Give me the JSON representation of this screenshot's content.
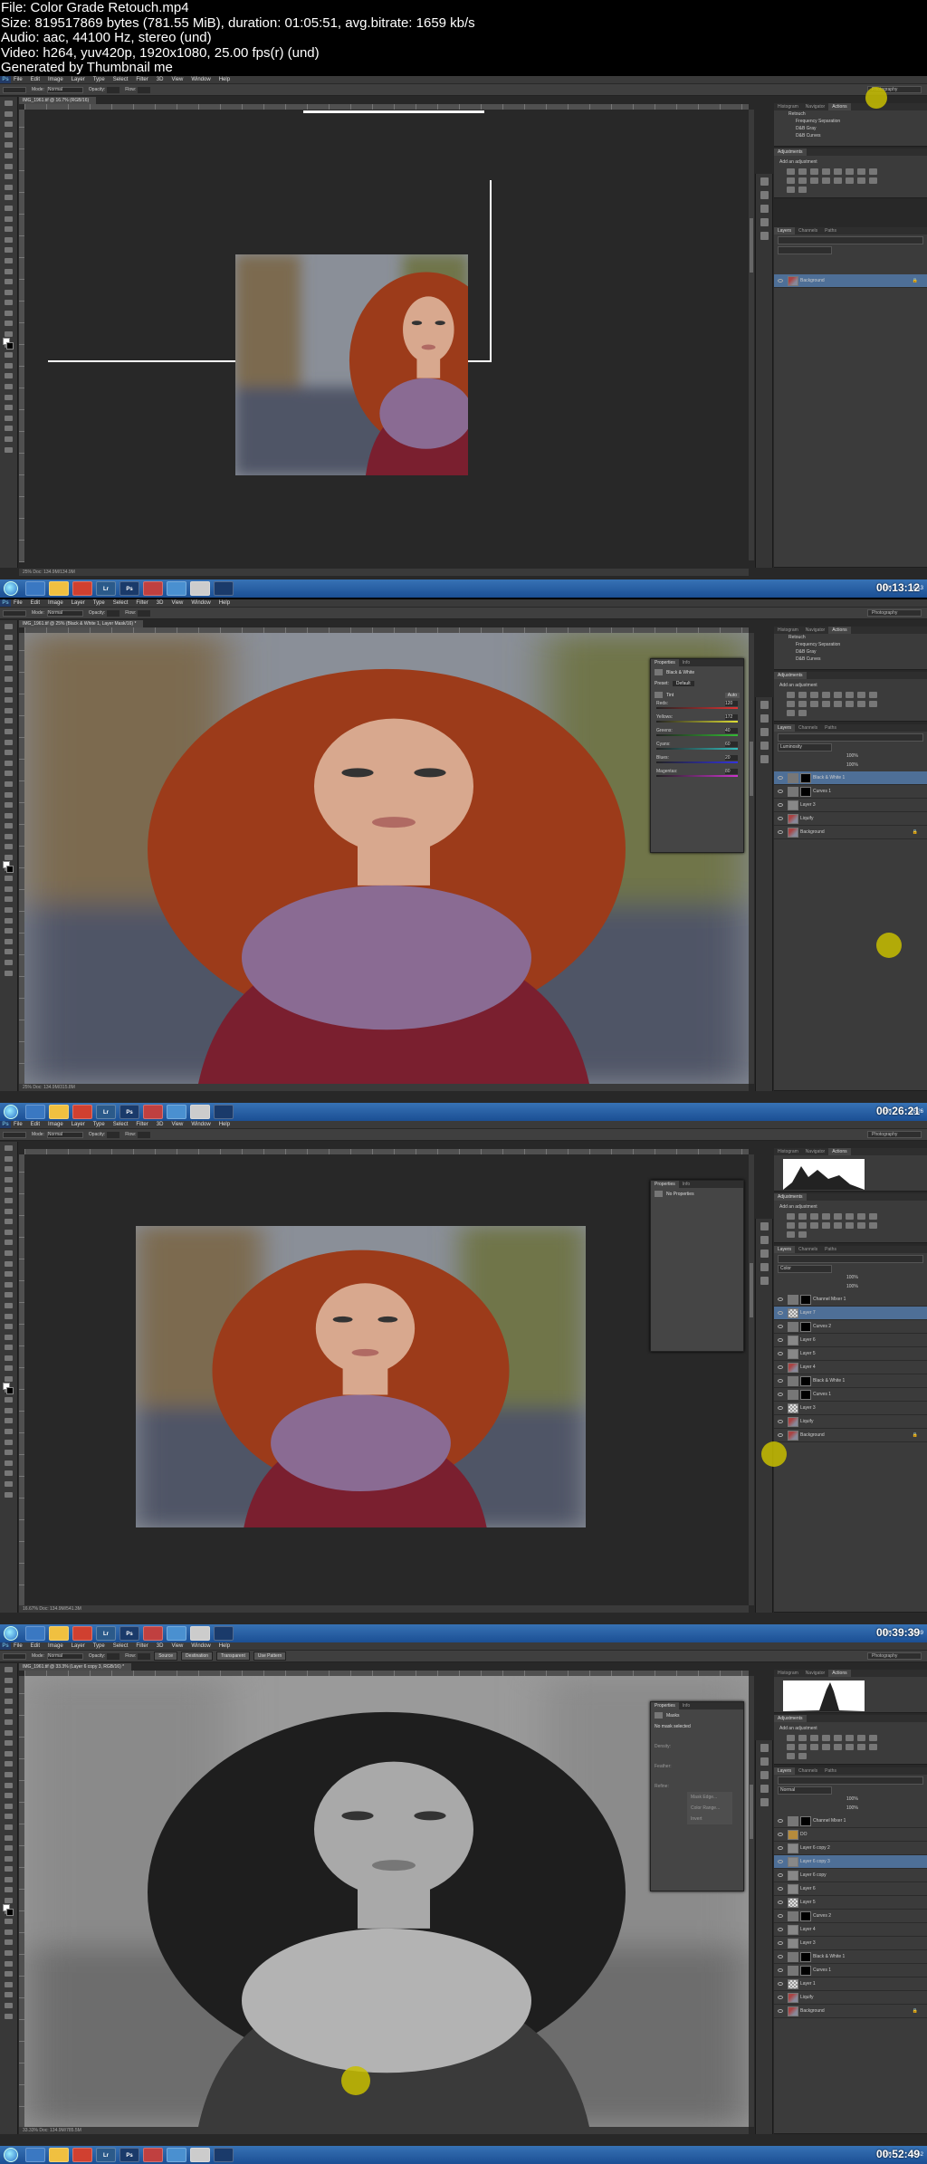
{
  "file_info": {
    "filename": "File: Color Grade Retouch.mp4",
    "size": "Size: 819517869 bytes (781.55 MiB), duration: 01:05:51, avg.bitrate: 1659 kb/s",
    "audio": "Audio: aac, 44100 Hz, stereo (und)",
    "video": "Video: h264, yuv420p, 1920x1080, 25.00 fps(r) (und)",
    "generator": "Generated by Thumbnail me"
  },
  "menus": [
    "File",
    "Edit",
    "Image",
    "Layer",
    "Type",
    "Select",
    "Filter",
    "3D",
    "View",
    "Window",
    "Help"
  ],
  "app_logo": "Ps",
  "workspace": "Photography",
  "options": {
    "mode_label": "Mode:",
    "mode_value": "Normal",
    "opacity_label": "Opacity:",
    "flow_label": "Flow:"
  },
  "panel_tabs": {
    "history": "Histogram",
    "navigator": "Navigator",
    "actions": "Actions",
    "properties": "Properties",
    "info": "Info",
    "adjustments": "Adjustments",
    "layers": "Layers",
    "channels": "Channels",
    "paths": "Paths"
  },
  "adjust_heading": "Add an adjustment",
  "actions_rows": [
    "Retouch",
    "Frequency Separation",
    "D&B Gray",
    "D&B Curves"
  ],
  "taskbar": {
    "lang": "EN",
    "apps": [
      "",
      "",
      "",
      "Lr",
      "Ps",
      "",
      "",
      "",
      ""
    ]
  },
  "frames": [
    {
      "doc_tab": "IMG_1961.tif @ 16.7% (RGB/16)",
      "status": "25%   Doc: 134.9M/134.9M",
      "timestamp": "00:13:12",
      "clock_time": "16:13",
      "clock_date": "",
      "layers": [
        {
          "name": "Background",
          "sel": true,
          "lock": true,
          "thumb": "photo"
        }
      ],
      "properties": null
    },
    {
      "doc_tab": "IMG_1961.tif @ 25% (Black & White 1, Layer Mask/16) *",
      "status": "25%   Doc: 134.9M/315.8M",
      "timestamp": "00:26:21",
      "clock_time": "16:26",
      "clock_date": "",
      "blend_mode": "Luminosity",
      "opacity": "100%",
      "fill": "100%",
      "layers": [
        {
          "name": "Black & White 1",
          "sel": true,
          "thumb": "adj"
        },
        {
          "name": "Curves 1",
          "thumb": "adj"
        },
        {
          "name": "Layer 3",
          "thumb": "gray"
        },
        {
          "name": "Liquify",
          "thumb": "photo"
        },
        {
          "name": "Background",
          "lock": true,
          "thumb": "photo"
        }
      ],
      "properties": {
        "title": "Black & White",
        "preset_label": "Preset:",
        "preset_value": "Default",
        "tint": "Tint",
        "auto": "Auto",
        "sliders": [
          {
            "label": "Reds:",
            "value": "120"
          },
          {
            "label": "Yellows:",
            "value": "172"
          },
          {
            "label": "Greens:",
            "value": "40"
          },
          {
            "label": "Cyans:",
            "value": "60"
          },
          {
            "label": "Blues:",
            "value": "20"
          },
          {
            "label": "Magentas:",
            "value": "80"
          }
        ]
      }
    },
    {
      "doc_tab": "",
      "status": "16.67%   Doc: 134.9M/541.3M",
      "timestamp": "00:39:39",
      "clock_time": "16:39",
      "clock_date": "",
      "blend_mode": "Color",
      "opacity": "100%",
      "fill": "100%",
      "layers": [
        {
          "name": "Channel Mixer 1",
          "thumb": "adj"
        },
        {
          "name": "Layer 7",
          "sel": true,
          "thumb": "check"
        },
        {
          "name": "Curves 2",
          "thumb": "adj"
        },
        {
          "name": "Layer 6",
          "thumb": "gray"
        },
        {
          "name": "Layer 5",
          "thumb": "gray"
        },
        {
          "name": "Layer 4",
          "thumb": "photo"
        },
        {
          "name": "Black & White 1",
          "thumb": "adj"
        },
        {
          "name": "Curves 1",
          "thumb": "adj"
        },
        {
          "name": "Layer 3",
          "thumb": "check"
        },
        {
          "name": "Liquify",
          "thumb": "photo"
        },
        {
          "name": "Background",
          "lock": true,
          "thumb": "photo"
        }
      ],
      "properties": {
        "title": "No Properties"
      }
    },
    {
      "doc_tab": "IMG_1961.tif @ 33.3% (Layer 6 copy 3, RGB/16) *",
      "status": "33.33%   Doc: 134.9M/785.5M",
      "timestamp": "00:52:49",
      "clock_time": "16:52",
      "clock_date": "",
      "options_extra": [
        "Source",
        "Destination",
        "Transparent",
        "Use Pattern"
      ],
      "blend_mode": "Normal",
      "opacity": "100%",
      "fill": "100%",
      "layers": [
        {
          "name": "Channel Mixer 1",
          "thumb": "adj"
        },
        {
          "name": "DO",
          "thumb": "folder"
        },
        {
          "name": "Layer 6 copy 2",
          "thumb": "gray"
        },
        {
          "name": "Layer 6 copy 3",
          "sel": true,
          "thumb": "gray"
        },
        {
          "name": "Layer 6 copy",
          "thumb": "gray"
        },
        {
          "name": "Layer 6",
          "thumb": "gray"
        },
        {
          "name": "Layer 5",
          "thumb": "check"
        },
        {
          "name": "Curves 2",
          "thumb": "adj"
        },
        {
          "name": "Layer 4",
          "thumb": "gray"
        },
        {
          "name": "Layer 3",
          "thumb": "gray"
        },
        {
          "name": "Black & White 1",
          "thumb": "adj"
        },
        {
          "name": "Curves 1",
          "thumb": "adj"
        },
        {
          "name": "Layer 1",
          "thumb": "check"
        },
        {
          "name": "Liquify",
          "thumb": "photo"
        },
        {
          "name": "Background",
          "lock": true,
          "thumb": "photo"
        }
      ],
      "properties": {
        "title": "Masks",
        "sub": "No mask selected",
        "density": "Density:",
        "feather": "Feather:",
        "refine": "Refine:",
        "b1": "Mask Edge...",
        "b2": "Color Range...",
        "b3": "Invert"
      }
    }
  ]
}
